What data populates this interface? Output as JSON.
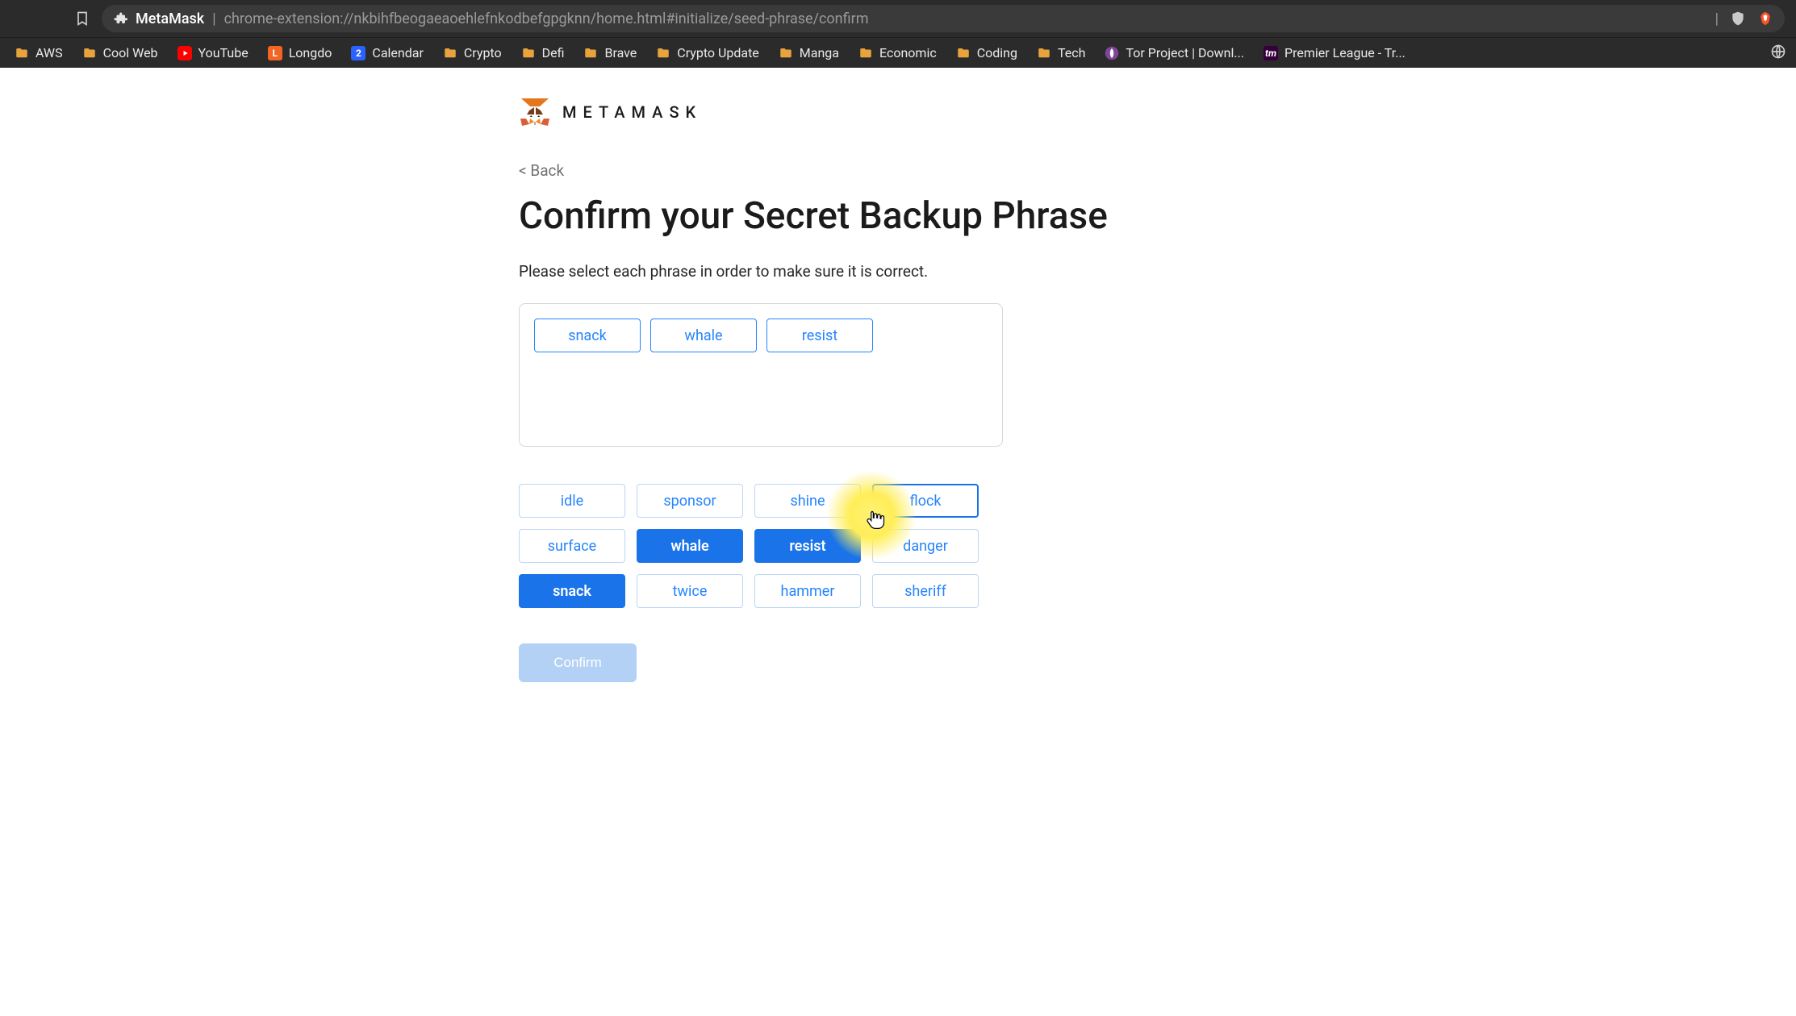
{
  "browser": {
    "tab_title": "MetaMask",
    "url": "chrome-extension://nkbihfbeogaeaoehlefnkodbefgpgknn/home.html#initialize/seed-phrase/confirm",
    "bookmarks": [
      {
        "label": "AWS",
        "icon": "folder"
      },
      {
        "label": "Cool Web",
        "icon": "folder"
      },
      {
        "label": "YouTube",
        "icon": "youtube"
      },
      {
        "label": "Longdo",
        "icon": "longdo"
      },
      {
        "label": "Calendar",
        "icon": "calendar"
      },
      {
        "label": "Crypto",
        "icon": "folder"
      },
      {
        "label": "Defi",
        "icon": "folder"
      },
      {
        "label": "Brave",
        "icon": "folder"
      },
      {
        "label": "Crypto Update",
        "icon": "folder"
      },
      {
        "label": "Manga",
        "icon": "folder"
      },
      {
        "label": "Economic",
        "icon": "folder"
      },
      {
        "label": "Coding",
        "icon": "folder"
      },
      {
        "label": "Tech",
        "icon": "folder"
      },
      {
        "label": "Tor Project | Downl...",
        "icon": "tor"
      },
      {
        "label": "Premier League - Tr...",
        "icon": "pl"
      }
    ]
  },
  "app": {
    "brand": "METAMASK",
    "back_label": "< Back",
    "title": "Confirm your Secret Backup Phrase",
    "subtitle": "Please select each phrase in order to make sure it is correct.",
    "selected_words": [
      "snack",
      "whale",
      "resist"
    ],
    "option_words": [
      {
        "word": "idle",
        "state": "default"
      },
      {
        "word": "sponsor",
        "state": "default"
      },
      {
        "word": "shine",
        "state": "default"
      },
      {
        "word": "flock",
        "state": "hovered"
      },
      {
        "word": "surface",
        "state": "default"
      },
      {
        "word": "whale",
        "state": "selected"
      },
      {
        "word": "resist",
        "state": "selected"
      },
      {
        "word": "danger",
        "state": "default"
      },
      {
        "word": "snack",
        "state": "selected"
      },
      {
        "word": "twice",
        "state": "default"
      },
      {
        "word": "hammer",
        "state": "default"
      },
      {
        "word": "sheriff",
        "state": "default"
      }
    ],
    "confirm_label": "Confirm"
  },
  "colors": {
    "accent": "#1a73e8",
    "accent_light": "#2684ff",
    "highlight": "#ffee58"
  }
}
